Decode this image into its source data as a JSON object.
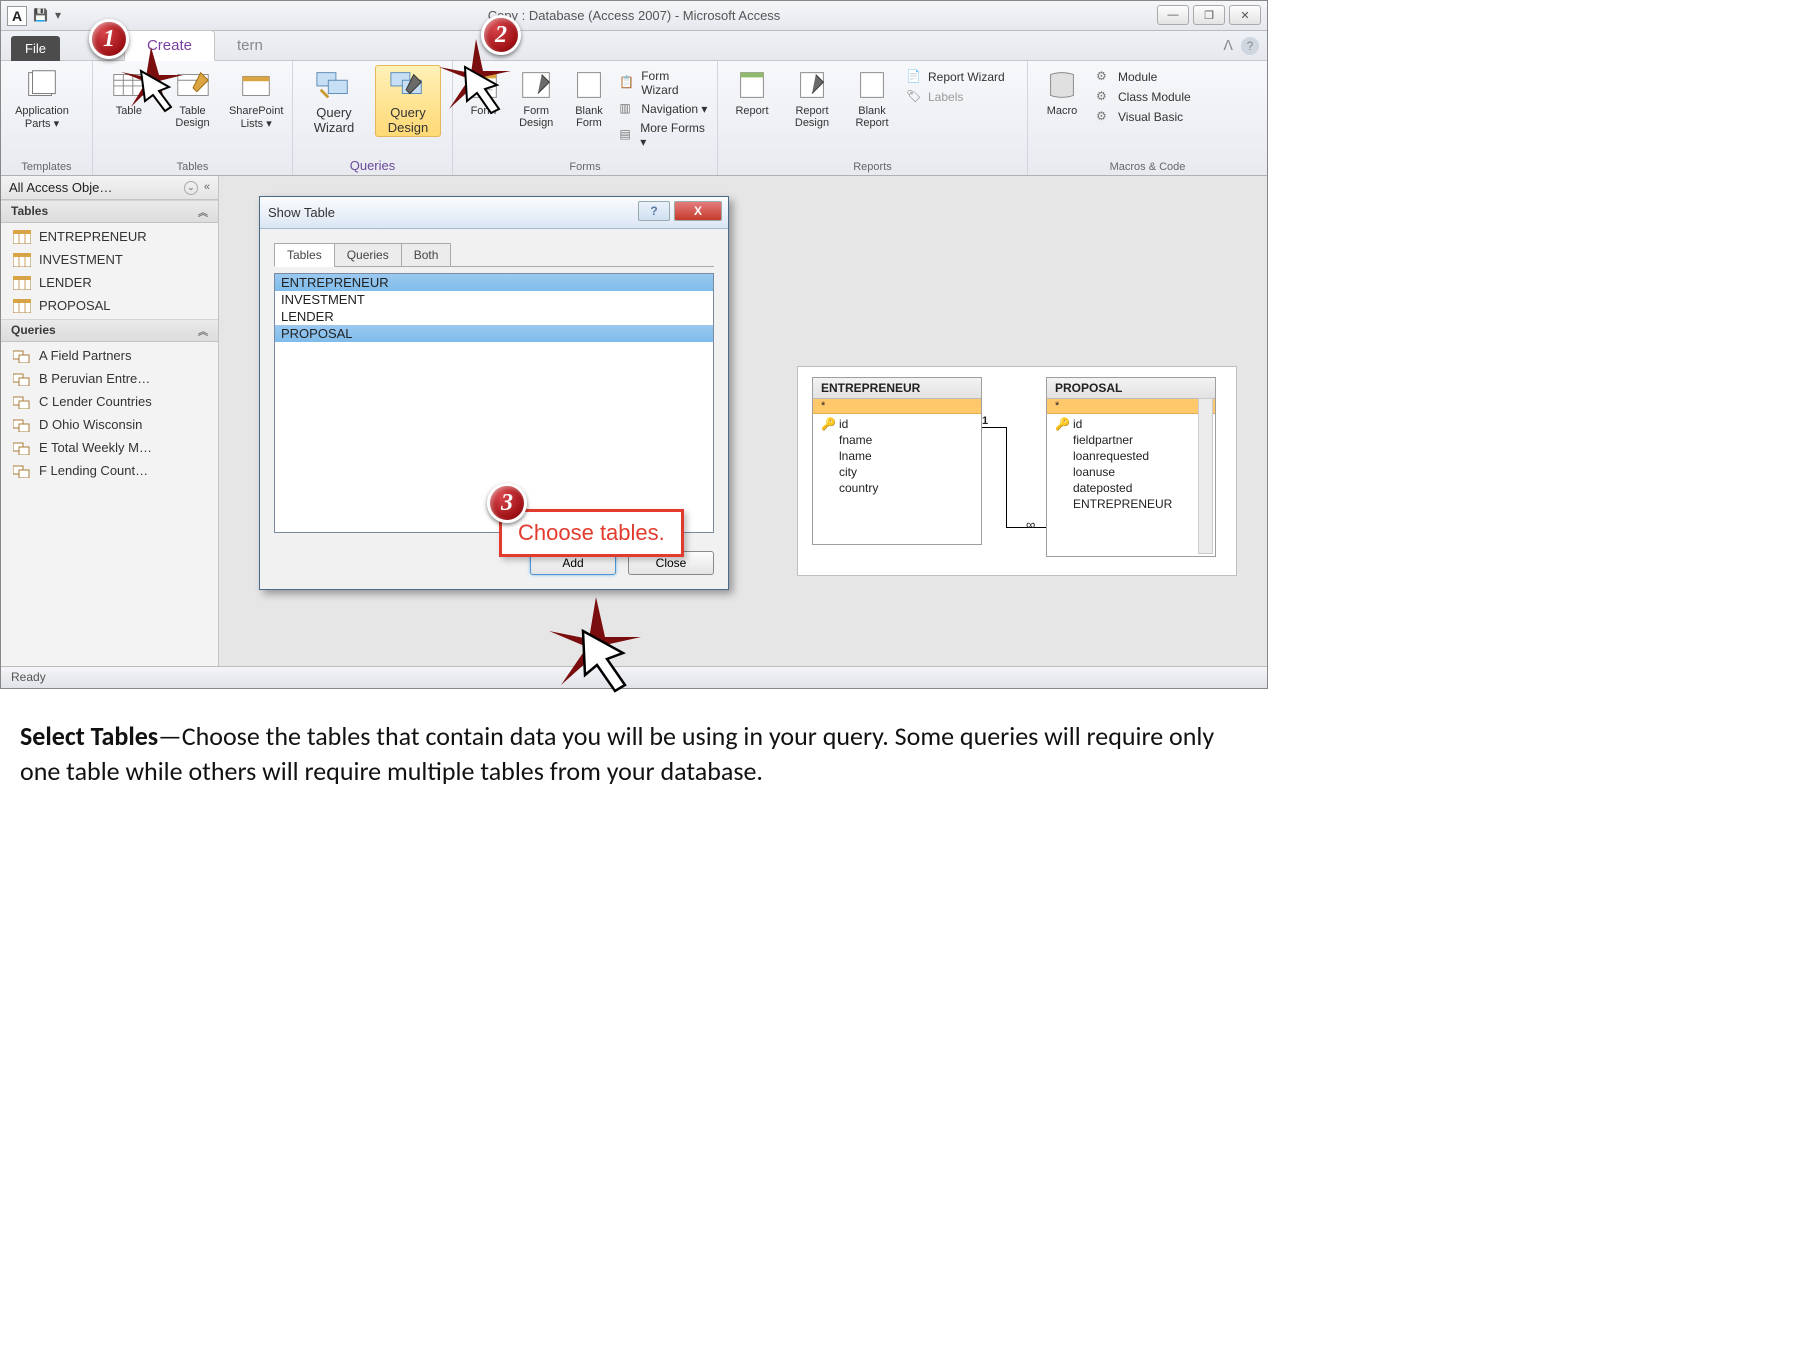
{
  "titlebar": {
    "title": "Copy : Database (Access 2007)  -  Microsoft Access"
  },
  "win": {
    "min": "—",
    "max": "❐",
    "close": "✕"
  },
  "tabs": {
    "file": "File",
    "create": "Create",
    "extern": "tern"
  },
  "help": {
    "caret": "ᐱ",
    "q": "?"
  },
  "ribbon": {
    "templates": {
      "app_parts": "Application\nParts ▾",
      "label": "Templates"
    },
    "tables": {
      "table": "Table",
      "design": "Table\nDesign",
      "sp": "SharePoint\nLists ▾",
      "label": "Tables"
    },
    "queries": {
      "wizard": "Query\nWizard",
      "design": "Query\nDesign",
      "label": "Queries"
    },
    "forms": {
      "form": "Form",
      "fdesign": "Form\nDesign",
      "blank": "Blank\nForm",
      "fw": "Form Wizard",
      "nav": "Navigation ▾",
      "more": "More Forms ▾",
      "label": "Forms"
    },
    "reports": {
      "report": "Report",
      "rdesign": "Report\nDesign",
      "blank": "Blank\nReport",
      "rw": "Report Wizard",
      "labels": "Labels",
      "label": "Reports"
    },
    "macros": {
      "macro": "Macro",
      "module": "Module",
      "class": "Class Module",
      "vb": "Visual Basic",
      "label": "Macros & Code"
    }
  },
  "nav": {
    "header": "All Access Obje…",
    "drop": "⌄",
    "collapse": "«",
    "cat_tables": "Tables",
    "cat_queries": "Queries",
    "chev": "︽",
    "tables": [
      "ENTREPRENEUR",
      "INVESTMENT",
      "LENDER",
      "PROPOSAL"
    ],
    "queries": [
      "A Field Partners",
      "B Peruvian Entre…",
      "C Lender Countries",
      "D Ohio Wisconsin",
      "E Total Weekly M…",
      "F Lending Count…"
    ]
  },
  "dialog": {
    "title": "Show Table",
    "tabs": {
      "tables": "Tables",
      "queries": "Queries",
      "both": "Both"
    },
    "items": [
      "ENTREPRENEUR",
      "INVESTMENT",
      "LENDER",
      "PROPOSAL"
    ],
    "add": "Add",
    "close": "Close"
  },
  "rel": {
    "left": {
      "title": "ENTREPRENEUR",
      "star": "*",
      "fields": [
        "id",
        "fname",
        "lname",
        "city",
        "country"
      ]
    },
    "right": {
      "title": "PROPOSAL",
      "star": "*",
      "fields": [
        "id",
        "fieldpartner",
        "loanrequested",
        "loanuse",
        "dateposted",
        "ENTREPRENEUR"
      ]
    },
    "one": "1",
    "many": "∞"
  },
  "status": "Ready",
  "annot": {
    "b1": "1",
    "b2": "2",
    "b3": "3",
    "callout": "Choose tables."
  },
  "caption": {
    "lead": "Select Tables",
    "dash": "—",
    "rest": "Choose the tables that contain data you will be using in your query.  Some queries will require only one table while others will require multiple tables from your database."
  }
}
